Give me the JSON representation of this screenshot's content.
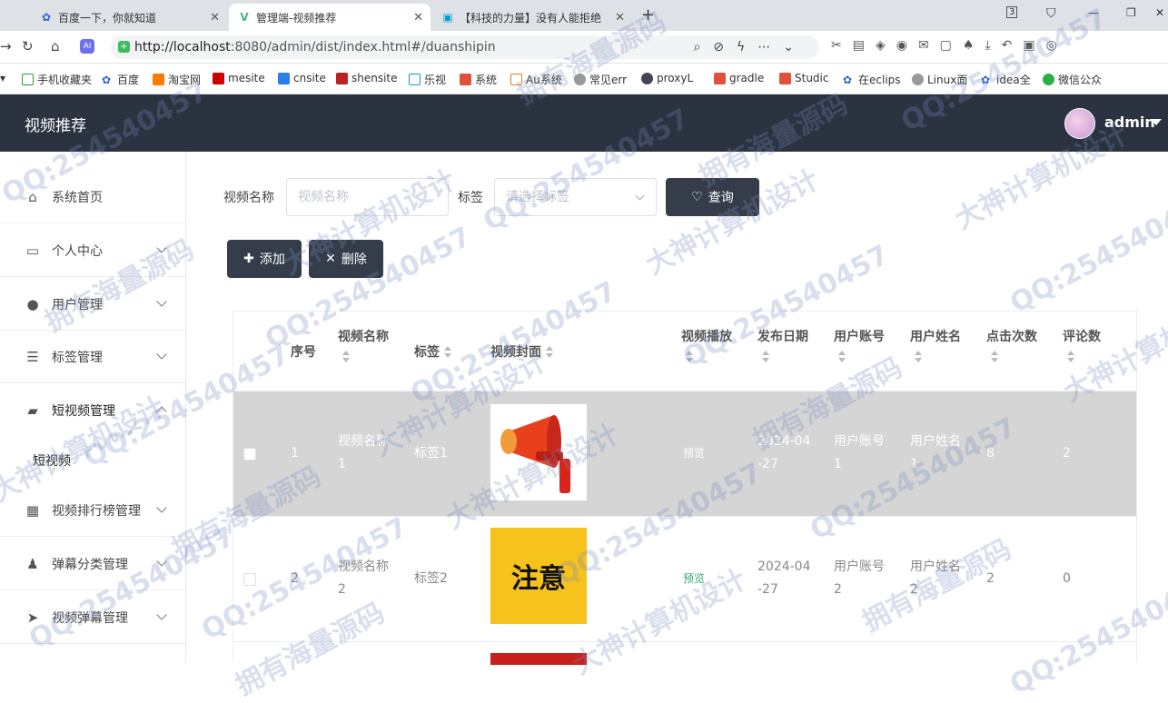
{
  "browser": {
    "tabs": [
      {
        "title": "百度一下，你就知道",
        "icon": "paw-icon"
      },
      {
        "title": "管理端-视频推荐",
        "icon": "vue-icon"
      },
      {
        "title": "【科技的力量】没有人能拒绝",
        "icon": "bilibili-icon"
      }
    ],
    "url_host": "http://localhost",
    "url_rest": ":8080/admin/dist/index.html#/duanshipin",
    "tab_count_badge": "3",
    "bookmarks": [
      "手机收藏夹",
      "百度",
      "淘宝网",
      "mesite",
      "cnsite",
      "shensite",
      "乐视",
      "系统",
      "Au系统",
      "常见err",
      "proxyL",
      "gradle",
      "Studic",
      "在eclips",
      "Linux面",
      "idea全",
      "微信公众"
    ]
  },
  "app": {
    "title": "视频推荐",
    "user": "admin"
  },
  "sidebar": {
    "items": [
      {
        "label": "系统首页",
        "icon": "home-icon"
      },
      {
        "label": "个人中心",
        "icon": "card-icon"
      },
      {
        "label": "用户管理",
        "icon": "user-icon"
      },
      {
        "label": "标签管理",
        "icon": "sliders-icon"
      },
      {
        "label": "短视频管理",
        "icon": "wallet-icon"
      },
      {
        "label": "视频排行榜管理",
        "icon": "grid-icon"
      },
      {
        "label": "弹幕分类管理",
        "icon": "person-icon"
      },
      {
        "label": "视频弹幕管理",
        "icon": "send-icon"
      }
    ],
    "sub_active": "短视频"
  },
  "search": {
    "name_label": "视频名称",
    "name_placeholder": "视频名称",
    "tag_label": "标签",
    "tag_placeholder": "请选择标签",
    "query_button": "查询"
  },
  "actions": {
    "add": "添加",
    "delete": "删除"
  },
  "table": {
    "headers": [
      "序号",
      "视频名称",
      "标签",
      "视频封面",
      "视频播放",
      "发布日期",
      "用户账号",
      "用户姓名",
      "点击次数",
      "评论数"
    ],
    "rows": [
      {
        "index": "1",
        "name_l1": "视频名称",
        "name_l2": "1",
        "tag": "标签1",
        "cover": "megaphone",
        "play": "预览",
        "date_l1": "2024-04",
        "date_l2": "-27",
        "account_l1": "用户账号",
        "account_l2": "1",
        "username_l1": "用户姓名",
        "username_l2": "1",
        "clicks": "8",
        "comments": "2"
      },
      {
        "index": "2",
        "name_l1": "视频名称",
        "name_l2": "2",
        "tag": "标签2",
        "cover": "注意",
        "play": "预览",
        "date_l1": "2024-04",
        "date_l2": "-27",
        "account_l1": "用户账号",
        "account_l2": "2",
        "username_l1": "用户姓名",
        "username_l2": "2",
        "clicks": "2",
        "comments": "0"
      }
    ]
  },
  "watermarks": [
    "QQ:254540457",
    "拥有海量源码",
    "大神计算机设计"
  ]
}
